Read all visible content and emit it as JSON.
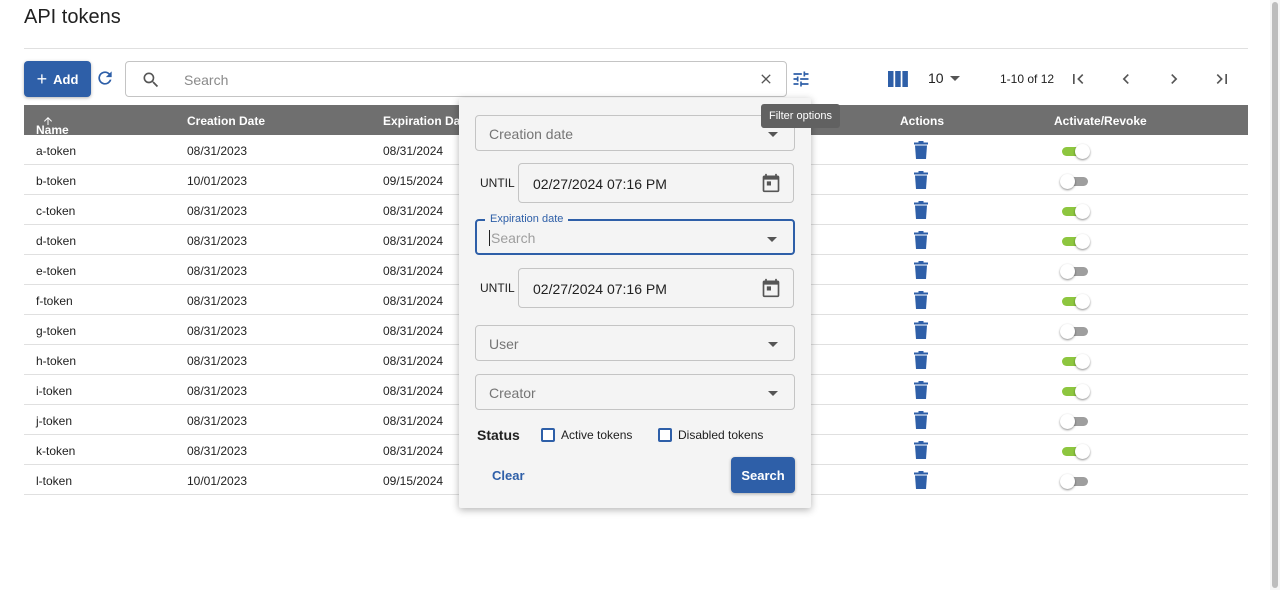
{
  "page": {
    "title": "API tokens"
  },
  "toolbar": {
    "add_label": "Add",
    "search_placeholder": "Search",
    "page_size": "10",
    "page_range": "1-10 of 12"
  },
  "tooltip": {
    "text": "Filter options"
  },
  "table": {
    "headers": {
      "name": "Name",
      "creation": "Creation Date",
      "expiration": "Expiration Dat",
      "actions": "Actions",
      "toggle": "Activate/Revoke"
    },
    "rows": [
      {
        "name": "a-token",
        "created": "08/31/2023",
        "expires": "08/31/2024",
        "active": true
      },
      {
        "name": "b-token",
        "created": "10/01/2023",
        "expires": "09/15/2024",
        "active": false
      },
      {
        "name": "c-token",
        "created": "08/31/2023",
        "expires": "08/31/2024",
        "active": true
      },
      {
        "name": "d-token",
        "created": "08/31/2023",
        "expires": "08/31/2024",
        "active": true
      },
      {
        "name": "e-token",
        "created": "08/31/2023",
        "expires": "08/31/2024",
        "active": false
      },
      {
        "name": "f-token",
        "created": "08/31/2023",
        "expires": "08/31/2024",
        "active": true
      },
      {
        "name": "g-token",
        "created": "08/31/2023",
        "expires": "08/31/2024",
        "active": false
      },
      {
        "name": "h-token",
        "created": "08/31/2023",
        "expires": "08/31/2024",
        "active": true
      },
      {
        "name": "i-token",
        "created": "08/31/2023",
        "expires": "08/31/2024",
        "active": true
      },
      {
        "name": "j-token",
        "created": "08/31/2023",
        "expires": "08/31/2024",
        "active": false
      },
      {
        "name": "k-token",
        "created": "08/31/2023",
        "expires": "08/31/2024",
        "active": true
      },
      {
        "name": "l-token",
        "created": "10/01/2023",
        "expires": "09/15/2024",
        "active": false
      }
    ]
  },
  "filter": {
    "creation_label": "Creation date",
    "until_label": "UNTIL",
    "creation_until": "02/27/2024 07:16 PM",
    "expiration_label": "Expiration date",
    "expiration_placeholder": "Search",
    "expiration_until": "02/27/2024 07:16 PM",
    "user_label": "User",
    "creator_label": "Creator",
    "status_label": "Status",
    "active_tokens_label": "Active tokens",
    "disabled_tokens_label": "Disabled tokens",
    "clear_label": "Clear",
    "search_label": "Search"
  },
  "colors": {
    "primary": "#2e5fa8",
    "toggle_on": "#8dc63f",
    "header_bg": "#6f6f6f"
  },
  "icons": [
    "refresh-icon",
    "search-icon",
    "close-icon",
    "filter-icon",
    "columns-icon",
    "first-page-icon",
    "prev-page-icon",
    "next-page-icon",
    "last-page-icon",
    "trash-icon",
    "calendar-icon",
    "sort-up-icon"
  ]
}
